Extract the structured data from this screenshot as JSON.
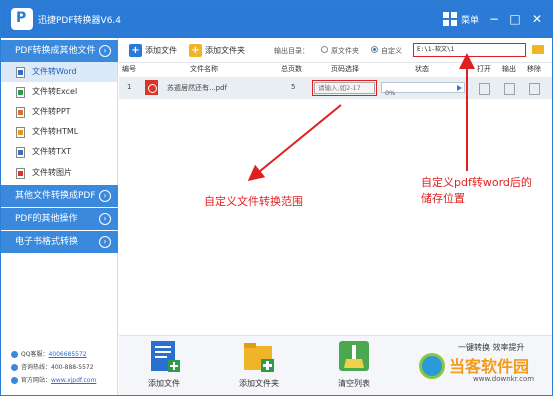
{
  "titlebar": {
    "title": "迅捷PDF转换器V6.4",
    "logo_letter": "P",
    "menu_label": "菜单"
  },
  "window_controls": {
    "minimize": "−",
    "maximize": "□",
    "close": "✕"
  },
  "sidebar": {
    "category_1": "PDF转换成其他文件",
    "items": [
      {
        "label": "文件转Word",
        "icon_color": "#2b6fd0"
      },
      {
        "label": "文件转Excel",
        "icon_color": "#2e9b4a"
      },
      {
        "label": "文件转PPT",
        "icon_color": "#e06b2b"
      },
      {
        "label": "文件转HTML",
        "icon_color": "#e39a1b"
      },
      {
        "label": "文件转TXT",
        "icon_color": "#3c6fb4"
      },
      {
        "label": "文件转图片",
        "icon_color": "#d9352b"
      }
    ],
    "category_2": "其他文件转换成PDF",
    "category_3": "PDF的其他操作",
    "category_4": "电子书格式转换",
    "arrow": "›",
    "contact": {
      "qq_label": "QQ客服：",
      "qq_value": "4006685572",
      "phone_label": "咨询热线：",
      "phone_value": "400-888-5572",
      "site_label": "官方网站：",
      "site_value": "www.xjpdf.com"
    }
  },
  "toolbar": {
    "add_file": "添加文件",
    "add_folder": "添加文件夹",
    "output_label": "输出目录：",
    "option_original": "原文件夹",
    "option_custom": "自定义",
    "output_path": "E:\\1-软文\\1"
  },
  "table": {
    "headers": {
      "num": "编号",
      "name": "文件名称",
      "pages": "总页数",
      "range": "页码选择",
      "status": "状态",
      "open": "打开",
      "output": "输出",
      "remove": "移除"
    },
    "rows": [
      {
        "num": "1",
        "name": "苏遁居然还有...pdf",
        "pages": "5",
        "range_placeholder": "请输入,如2-17",
        "progress": "0%"
      }
    ]
  },
  "annotations": {
    "range_note": "自定义文件转换范围",
    "path_note_line1": "自定义pdf转word后的",
    "path_note_line2": "储存位置"
  },
  "bottom": {
    "add_file": "添加文件",
    "add_folder": "添加文件夹",
    "clear_list": "清空列表",
    "slogan": "一键转换  效率提升"
  },
  "watermark": {
    "text": "当客软件园",
    "url": "www.downkr.com"
  },
  "colors": {
    "brand_blue": "#2b7bd6",
    "annotation_red": "#e02020",
    "active_row": "#dce9f8"
  }
}
